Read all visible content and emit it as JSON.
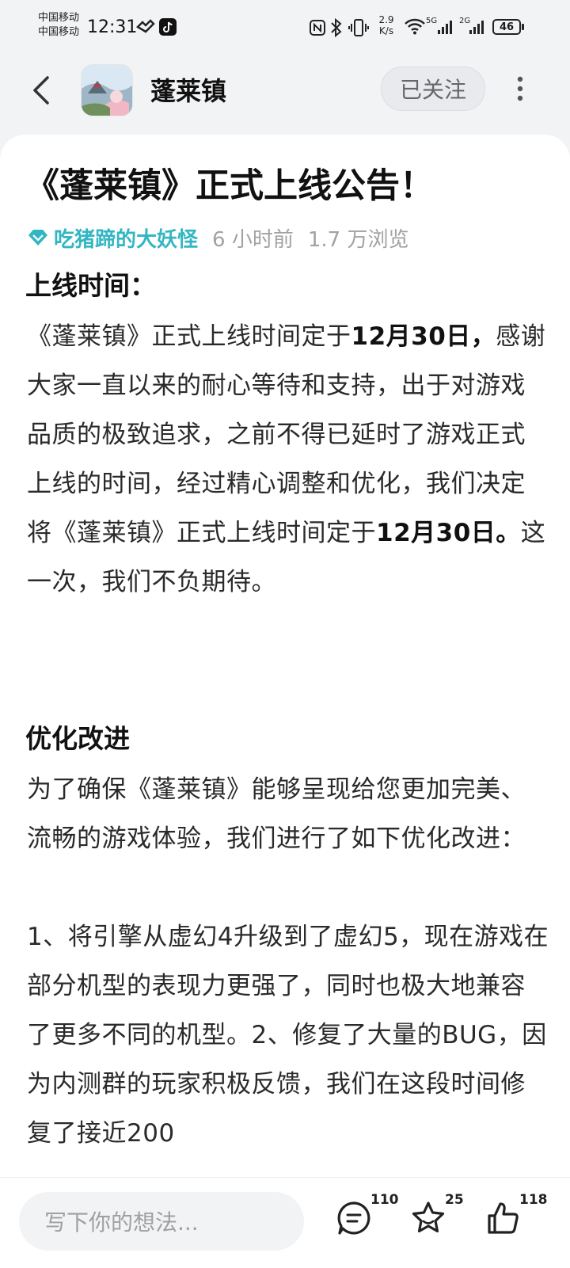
{
  "status_bar": {
    "carrier_1": "中国移动",
    "carrier_2": "中国移动",
    "time": "12:31",
    "speed_value": "2.9",
    "speed_unit": "K/s",
    "net_1": "5G",
    "net_2": "2G",
    "battery": "46"
  },
  "header": {
    "title": "蓬莱镇",
    "follow_label": "已关注"
  },
  "article": {
    "title": "《蓬莱镇》正式上线公告！",
    "author": "吃猪蹄的大妖怪",
    "time_ago": "6 小时前",
    "views": "1.7 万浏览",
    "section1_heading": "上线时间：",
    "p1_a": "《蓬莱镇》正式上线时间定于",
    "p1_bold1": "12月30日，",
    "p1_b": "感谢大家一直以来的耐心等待和支持，出于对游戏品质的极致追求，之前不得已延时了游戏正式上线的时间，经过精心调整和优化，我们决定将《蓬莱镇》正式上线时间定于",
    "p1_bold2": "12月30日。",
    "p1_c": "这一次，我们不负期待。",
    "section2_heading": "优化改进",
    "p2": "为了确保《蓬莱镇》能够呈现给您更加完美、流畅的游戏体验，我们进行了如下优化改进：",
    "p3": "1、将引擎从虚幻4升级到了虚幻5，现在游戏在部分机型的表现力更强了，同时也极大地兼容了更多不同的机型。2、修复了大量的BUG，因为内测群的玩家积极反馈，我们在这段时间修复了接近200"
  },
  "bottom_bar": {
    "input_placeholder": "写下你的想法...",
    "comments": "110",
    "favorites": "25",
    "likes": "118"
  },
  "colors": {
    "accent": "#33B6C3",
    "background": "#F2F3F5"
  }
}
